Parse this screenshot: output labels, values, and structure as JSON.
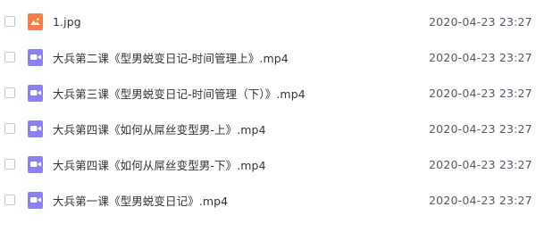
{
  "colors": {
    "image_icon": "#f97d47",
    "video_icon": "#8b80f2"
  },
  "files": [
    {
      "name": "1.jpg",
      "date": "2020-04-23 23:27",
      "icon": "image-icon"
    },
    {
      "name": "大兵第二课《型男蜕变日记-时间管理上》.mp4",
      "date": "2020-04-23 23:27",
      "icon": "video-icon"
    },
    {
      "name": "大兵第三课《型男蜕变日记-时间管理（下）》.mp4",
      "date": "2020-04-23 23:27",
      "icon": "video-icon"
    },
    {
      "name": "大兵第四课《如何从屌丝变型男-上》.mp4",
      "date": "2020-04-23 23:27",
      "icon": "video-icon"
    },
    {
      "name": "大兵第四课《如何从屌丝变型男-下》.mp4",
      "date": "2020-04-23 23:27",
      "icon": "video-icon"
    },
    {
      "name": "大兵第一课《型男蜕变日记》.mp4",
      "date": "2020-04-23 23:27",
      "icon": "video-icon"
    }
  ]
}
